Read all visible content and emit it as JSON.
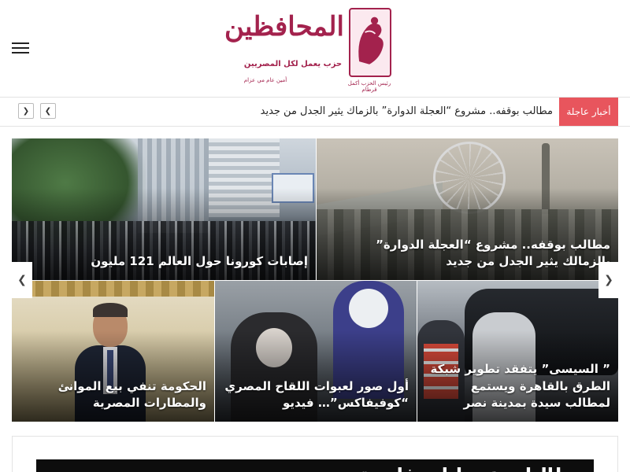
{
  "header": {
    "menu_icon": "hamburger-menu-icon",
    "logo": {
      "title": "المحافظين",
      "slogan": "حزب يعمل لكل المصريين",
      "small_left": "أمين عام مي عزام",
      "small_right": "رئيس الحزب أكمل قرطام",
      "colors": {
        "brand": "#a3224d"
      }
    }
  },
  "ticker": {
    "label": "أخبار عاجلة",
    "text": "مطالب بوقفه.. مشروع “العجلة الدوارة” بالزماك يثير الجدل من جديد",
    "prev_icon": "chevron-left-icon",
    "next_icon": "chevron-right-icon",
    "colors": {
      "label_bg": "#e8555d"
    }
  },
  "featured": {
    "tiles": [
      {
        "id": "covid",
        "caption": "إصابات كورونا حول العالم 121 مليون"
      },
      {
        "id": "ferris",
        "caption": "مطالب بوقفه.. مشروع “العجلة الدوارة” بالزمالك يثير الجدل من جديد"
      },
      {
        "id": "gov",
        "caption": "الحكومة تنفي بيع الموانئ والمطارات المصرية"
      },
      {
        "id": "vax",
        "caption": "أول صور لعبوات اللقاح المصري “كوفيفاكس”… فيديو"
      },
      {
        "id": "sisi",
        "caption": "” السيسى” يتفقد تطوير شبكة الطرق بالقاهرة ويستمع لمطالب سيدة بمدينة نصر"
      }
    ],
    "slider_left_icon": "chevron-left-icon",
    "slider_right_icon": "chevron-right-icon"
  },
  "section": {
    "heading": "مطالبات عمرانات فاصبة"
  }
}
